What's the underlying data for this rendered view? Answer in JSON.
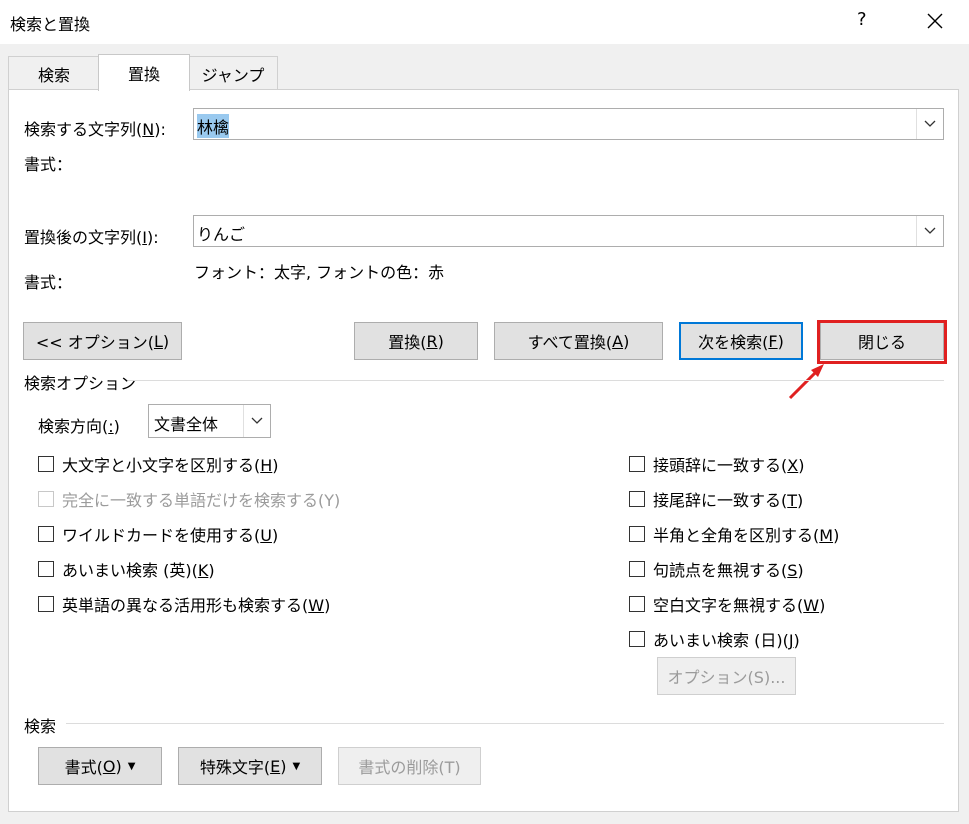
{
  "window": {
    "title": "検索と置換",
    "help": "?"
  },
  "tabs": [
    {
      "label": "検索",
      "active": false
    },
    {
      "label": "置換",
      "active": true
    },
    {
      "label": "ジャンプ",
      "active": false
    }
  ],
  "find": {
    "label": "検索する文字列(",
    "hotkey": "N",
    "label_end": "):",
    "value": "林檎",
    "format_label": "書式："
  },
  "replace": {
    "label": "置換後の文字列(",
    "hotkey": "I",
    "label_end": "):",
    "value": "りんご",
    "format_label": "書式：",
    "format_value": "フォント：太字, フォントの色：赤"
  },
  "buttons": {
    "options": {
      "pre": "<< オプション(",
      "key": "L",
      "post": ")"
    },
    "replace": {
      "pre": "置換(",
      "key": "R",
      "post": ")"
    },
    "replace_all": {
      "pre": "すべて置換(",
      "key": "A",
      "post": ")"
    },
    "find_next": {
      "pre": "次を検索(",
      "key": "F",
      "post": ")"
    },
    "close": "閉じる"
  },
  "search_options": {
    "heading": "検索オプション",
    "direction_label": "検索方向(",
    "direction_key": ":",
    "direction_end": ")",
    "direction_value": "文書全体",
    "left_checks": [
      {
        "pre": "大文字と小文字を区別する(",
        "key": "H",
        "post": ")",
        "enabled": true
      },
      {
        "pre": "完全に一致する単語だけを検索する(Y)",
        "key": "",
        "post": "",
        "enabled": false
      },
      {
        "pre": "ワイルドカードを使用する(",
        "key": "U",
        "post": ")",
        "enabled": true
      },
      {
        "pre": "あいまい検索 (英)(",
        "key": "K",
        "post": ")",
        "enabled": true
      },
      {
        "pre": "英単語の異なる活用形も検索する(",
        "key": "W",
        "post": ")",
        "enabled": true
      }
    ],
    "right_checks": [
      {
        "pre": "接頭辞に一致する(",
        "key": "X",
        "post": ")"
      },
      {
        "pre": "接尾辞に一致する(",
        "key": "T",
        "post": ")"
      },
      {
        "pre": "半角と全角を区別する(",
        "key": "M",
        "post": ")"
      },
      {
        "pre": "句読点を無視する(",
        "key": "S",
        "post": ")"
      },
      {
        "pre": "空白文字を無視する(",
        "key": "W",
        "post": ")"
      },
      {
        "pre": "あいまい検索 (日)(",
        "key": "J",
        "post": ")"
      }
    ],
    "fuzzy_options_button": "オプション(S)..."
  },
  "search_section": {
    "heading": "検索",
    "format_btn": {
      "pre": "書式(",
      "key": "O",
      "post": ")"
    },
    "special_btn": {
      "pre": "特殊文字(",
      "key": "E",
      "post": ")"
    },
    "clear_btn": "書式の削除(T)"
  },
  "colors": {
    "highlight": "#e02020",
    "accent": "#0078d7"
  },
  "icons": {
    "close": "close-icon",
    "dropdown": "chevron-down-icon",
    "arrow": "red-arrow-annotation"
  }
}
